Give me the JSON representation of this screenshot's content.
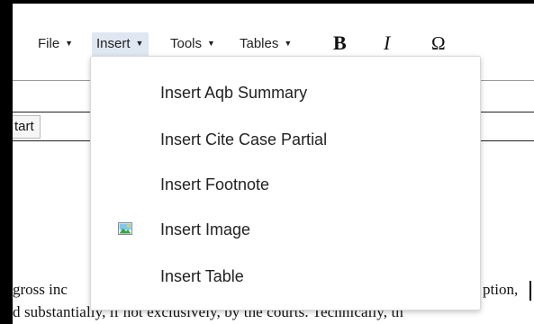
{
  "menubar": {
    "file_label": "File",
    "insert_label": "Insert",
    "tools_label": "Tools",
    "tables_label": "Tables",
    "caret": "▼",
    "bold_label": "B",
    "italic_label": "I",
    "special_char_label": "Ω"
  },
  "insert_menu": {
    "items": [
      {
        "label": "Insert Aqb Summary",
        "icon": null
      },
      {
        "label": "Insert Cite Case Partial",
        "icon": null
      },
      {
        "label": "Insert Footnote",
        "icon": null
      },
      {
        "label": "Insert Image",
        "icon": "image-icon"
      },
      {
        "label": "Insert Table",
        "icon": null
      }
    ]
  },
  "toolbar": {
    "start_label": "tart"
  },
  "document": {
    "line1_left": "gross inc",
    "line1_right": "ption,",
    "line2": "d substantially, if not exclusively, by the courts. Technically, th"
  },
  "colors": {
    "menu_active_bg": "#dfe7f2",
    "image_icon_green": "#3aa34a",
    "image_icon_sky": "#7ec8f0"
  }
}
